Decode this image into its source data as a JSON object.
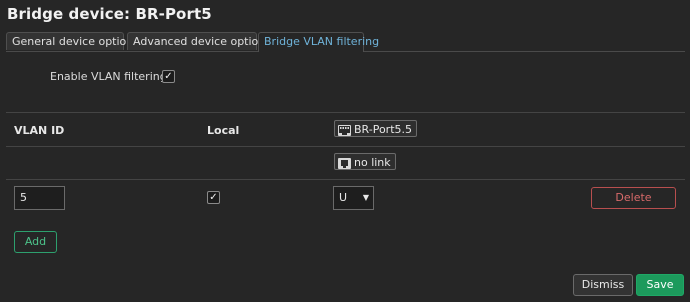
{
  "dialog": {
    "title": "Bridge device: BR-Port5"
  },
  "tabs": [
    {
      "label": "General device options"
    },
    {
      "label": "Advanced device options"
    },
    {
      "label": "Bridge VLAN filtering"
    }
  ],
  "vlan_filtering": {
    "label": "Enable VLAN filtering",
    "checked": true,
    "check_glyph": "✓"
  },
  "table": {
    "headers": {
      "vlan_id": "VLAN ID",
      "local": "Local"
    },
    "port": {
      "name": "BR-Port5.5",
      "icon": "ethernet-port-icon"
    },
    "link_status": {
      "label": "no link",
      "icon": "no-link-icon"
    },
    "rows": [
      {
        "vlan_id": "5",
        "local_checked": true,
        "local_glyph": "✓",
        "tagging": "U",
        "delete_label": "Delete"
      }
    ]
  },
  "actions": {
    "add_label": "Add",
    "dismiss_label": "Dismiss",
    "save_label": "Save"
  },
  "colors": {
    "accent_tab": "#6fb3d9",
    "delete": "#d86a6a",
    "add": "#4cc38a",
    "save": "#1c9a5c"
  }
}
